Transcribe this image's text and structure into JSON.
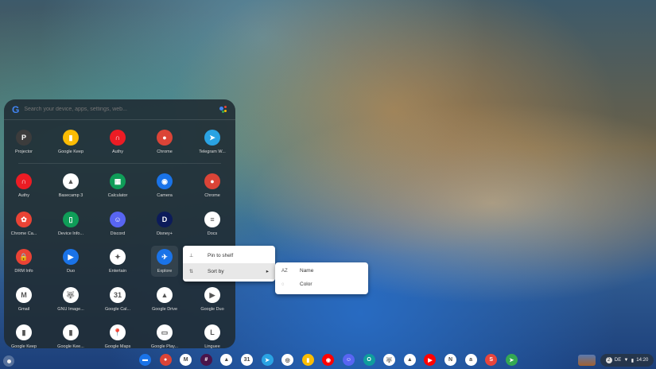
{
  "launcher": {
    "search_placeholder": "Search your device, apps, settings, web...",
    "google_logo": "G",
    "recent": [
      {
        "label": "Projector",
        "color": "#3c3c3c",
        "glyph": "P"
      },
      {
        "label": "Google Keep",
        "color": "#fbbc04",
        "glyph": "▮"
      },
      {
        "label": "Authy",
        "color": "#ec1c24",
        "glyph": "∩"
      },
      {
        "label": "Chrome",
        "color": "#db4437",
        "glyph": "●"
      },
      {
        "label": "Telegram W...",
        "color": "#2aa3e3",
        "glyph": "➤"
      }
    ],
    "apps": [
      {
        "label": "Authy",
        "color": "#ec1c24",
        "glyph": "∩"
      },
      {
        "label": "Basecamp 3",
        "color": "#ffffff",
        "glyph": "▲"
      },
      {
        "label": "Calculator",
        "color": "#0f9d58",
        "glyph": "▦"
      },
      {
        "label": "Camera",
        "color": "#1a73e8",
        "glyph": "◉"
      },
      {
        "label": "Chrome",
        "color": "#db4437",
        "glyph": "●"
      },
      {
        "label": "Chrome Ca...",
        "color": "#ea4335",
        "glyph": "✿"
      },
      {
        "label": "Device Info...",
        "color": "#0f9d58",
        "glyph": "▯"
      },
      {
        "label": "Discord",
        "color": "#5865f2",
        "glyph": "☺"
      },
      {
        "label": "Disney+",
        "color": "#0c1b5a",
        "glyph": "D"
      },
      {
        "label": "Docs",
        "color": "#ffffff",
        "glyph": "≡"
      },
      {
        "label": "DRM Info",
        "color": "#ea4335",
        "glyph": "🔒"
      },
      {
        "label": "Duo",
        "color": "#1a73e8",
        "glyph": "▶"
      },
      {
        "label": "Entertain",
        "color": "#ffffff",
        "glyph": "✦"
      },
      {
        "label": "Explore",
        "color": "#1a73e8",
        "glyph": "✈"
      },
      {
        "label": "",
        "color": "transparent",
        "glyph": ""
      },
      {
        "label": "Gmail",
        "color": "#ffffff",
        "glyph": "M"
      },
      {
        "label": "GNU Image...",
        "color": "#ffffff",
        "glyph": "🐺"
      },
      {
        "label": "Google Cal...",
        "color": "#ffffff",
        "glyph": "31"
      },
      {
        "label": "Google Drive",
        "color": "#ffffff",
        "glyph": "▲"
      },
      {
        "label": "Google Duo",
        "color": "#ffffff",
        "glyph": "▶"
      },
      {
        "label": "Google Keep",
        "color": "#ffffff",
        "glyph": "▮"
      },
      {
        "label": "Google Kee...",
        "color": "#ffffff",
        "glyph": "▮"
      },
      {
        "label": "Google Maps",
        "color": "#ffffff",
        "glyph": "📍"
      },
      {
        "label": "Google Play...",
        "color": "#ffffff",
        "glyph": "▭"
      },
      {
        "label": "Linguee",
        "color": "#ffffff",
        "glyph": "L"
      }
    ]
  },
  "context_menu": {
    "items": [
      {
        "label": "Pin to shelf",
        "icon": "pin-icon",
        "glyph": "⊥"
      },
      {
        "label": "Sort by",
        "icon": "sort-icon",
        "glyph": "⇅",
        "arrow": "▸"
      }
    ]
  },
  "submenu": {
    "items": [
      {
        "label": "Name",
        "icon": "az-icon",
        "glyph": "AZ"
      },
      {
        "label": "Color",
        "icon": "palette-icon",
        "glyph": "◌"
      }
    ]
  },
  "shelf": {
    "apps": [
      {
        "name": "files",
        "color": "#1a73e8",
        "glyph": "▬"
      },
      {
        "name": "chrome",
        "color": "#db4437",
        "glyph": "●"
      },
      {
        "name": "gmail",
        "color": "#ffffff",
        "glyph": "M"
      },
      {
        "name": "slack",
        "color": "#4a154b",
        "glyph": "#"
      },
      {
        "name": "basecamp",
        "color": "#ffffff",
        "glyph": "▲"
      },
      {
        "name": "google-calendar",
        "color": "#ffffff",
        "glyph": "31"
      },
      {
        "name": "telegram",
        "color": "#2aa3e3",
        "glyph": "➤"
      },
      {
        "name": "whatsapp",
        "color": "#ffffff",
        "glyph": "◎"
      },
      {
        "name": "google-keep",
        "color": "#fbbc04",
        "glyph": "▮"
      },
      {
        "name": "youtube-music",
        "color": "#ff0000",
        "glyph": "◉"
      },
      {
        "name": "discord",
        "color": "#5865f2",
        "glyph": "☺"
      },
      {
        "name": "outlook",
        "color": "#0f9d9d",
        "glyph": "O"
      },
      {
        "name": "gimp",
        "color": "#ffffff",
        "glyph": "🐺"
      },
      {
        "name": "google-drive",
        "color": "#ffffff",
        "glyph": "▲"
      },
      {
        "name": "youtube",
        "color": "#ff0000",
        "glyph": "▶"
      },
      {
        "name": "netflix",
        "color": "#ffffff",
        "glyph": "N"
      },
      {
        "name": "amazon",
        "color": "#ffffff",
        "glyph": "a"
      },
      {
        "name": "stadia",
        "color": "#e8453c",
        "glyph": "S"
      },
      {
        "name": "send",
        "color": "#34a853",
        "glyph": "➤"
      }
    ]
  },
  "tray": {
    "notifications": "2",
    "keyboard": "DE",
    "wifi": "▼",
    "battery": "▮",
    "time": "14:20"
  }
}
